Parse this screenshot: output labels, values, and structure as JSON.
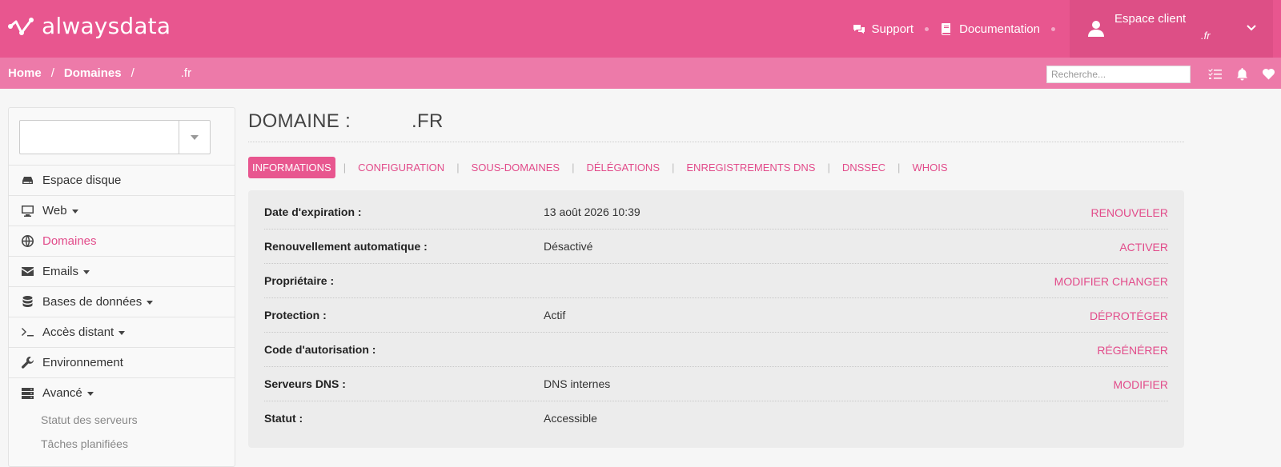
{
  "header": {
    "logo_text": "alwaysdata",
    "support": "Support",
    "documentation": "Documentation",
    "account_title": "Espace client",
    "account_sub": ".fr"
  },
  "breadcrumb": {
    "home": "Home",
    "domains": "Domaines",
    "current": ".fr"
  },
  "search": {
    "placeholder": "Recherche..."
  },
  "sidebar": {
    "items": [
      {
        "label": "Espace disque",
        "icon": "hdd-icon",
        "dropdown": false
      },
      {
        "label": "Web",
        "icon": "monitor-icon",
        "dropdown": true
      },
      {
        "label": "Domaines",
        "icon": "globe-icon",
        "dropdown": false,
        "active": true
      },
      {
        "label": "Emails",
        "icon": "envelope-icon",
        "dropdown": true
      },
      {
        "label": "Bases de données",
        "icon": "database-icon",
        "dropdown": true
      },
      {
        "label": "Accès distant",
        "icon": "terminal-icon",
        "dropdown": true
      },
      {
        "label": "Environnement",
        "icon": "wrench-icon",
        "dropdown": false
      },
      {
        "label": "Avancé",
        "icon": "server-icon",
        "dropdown": true
      }
    ],
    "sub_items": [
      "Statut des serveurs",
      "Tâches planifiées"
    ]
  },
  "main": {
    "title_prefix": "DOMAINE :",
    "title_tld": ".FR",
    "tabs": [
      "INFORMATIONS",
      "CONFIGURATION",
      "SOUS-DOMAINES",
      "DÉLÉGATIONS",
      "ENREGISTREMENTS DNS",
      "DNSSEC",
      "WHOIS"
    ],
    "rows": [
      {
        "label": "Date d'expiration :",
        "value": "13 août 2026 10:39",
        "action": "RENOUVELER"
      },
      {
        "label": "Renouvellement automatique :",
        "value": "Désactivé",
        "action": "ACTIVER"
      },
      {
        "label": "Propriétaire :",
        "value": "",
        "action": "MODIFIER CHANGER"
      },
      {
        "label": "Protection :",
        "value": "Actif",
        "action": "DÉPROTÉGER"
      },
      {
        "label": "Code d'autorisation :",
        "value": "",
        "action": "RÉGÉNÉRER"
      },
      {
        "label": "Serveurs DNS :",
        "value": "DNS internes",
        "action": "MODIFIER"
      },
      {
        "label": "Statut :",
        "value": "Accessible",
        "action": ""
      }
    ]
  },
  "colors": {
    "brand": "#e8568f",
    "brand_light": "#ed7aa9",
    "link": "#e24b8a"
  }
}
